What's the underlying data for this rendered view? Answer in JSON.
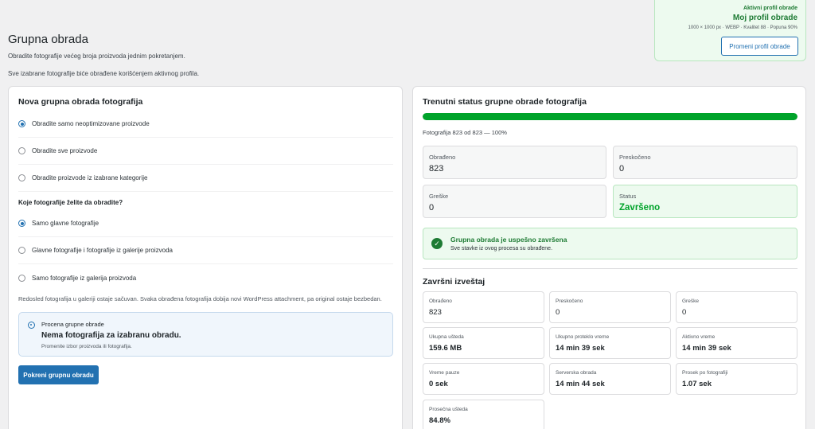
{
  "header": {
    "title": "Grupna obrada",
    "description": "Obradite fotografije većeg broja proizvoda jednim pokretanjem.",
    "description2": "Sve izabrane fotografije biće obrađene korišćenjem aktivnog profila."
  },
  "profile": {
    "label": "Aktivni profil obrade",
    "name": "Moj profil obrade",
    "meta": "1000 × 1000 px · WEBP · Kvalitet 88 · Popuna 90%",
    "button": "Promeni profil obrade"
  },
  "left": {
    "title": "Nova grupna obrada fotografija",
    "scope_options": [
      {
        "label": "Obradite samo neoptimizovane proizvode",
        "checked": true
      },
      {
        "label": "Obradite sve proizvode",
        "checked": false
      },
      {
        "label": "Obradite proizvode iz izabrane kategorije",
        "checked": false
      }
    ],
    "question": "Koje fotografije želite da obradite?",
    "photo_options": [
      {
        "label": "Samo glavne fotografije",
        "checked": true
      },
      {
        "label": "Glavne fotografije i fotografije iz galerije proizvoda",
        "checked": false
      },
      {
        "label": "Samo fotografije iz galerija proizvoda",
        "checked": false
      }
    ],
    "note": "Redosled fotografija u galeriji ostaje sačuvan. Svaka obrađena fotografija dobija novi WordPress attachment, pa original ostaje bezbedan.",
    "estimate": {
      "label": "Procena grupne obrade",
      "title": "Nema fotografija za izabranu obradu.",
      "sub": "Promenite izbor proizvoda ili fotografija."
    },
    "run_button": "Pokreni grupnu obradu"
  },
  "right": {
    "title": "Trenutni status grupne obrade fotografija",
    "progress_text": "Fotografija 823 od 823 — 100%",
    "progress_percent": 100,
    "stats": [
      {
        "label": "Obrađeno",
        "value": "823"
      },
      {
        "label": "Preskočeno",
        "value": "0"
      },
      {
        "label": "Greške",
        "value": "0"
      },
      {
        "label": "Status",
        "value": "Završeno"
      }
    ],
    "success": {
      "title": "Grupna obrada je uspešno završena",
      "sub": "Sve stavke iz ovog procesa su obrađene."
    },
    "report_title": "Završni izveštaj",
    "report": [
      {
        "label": "Obrađeno",
        "value": "823"
      },
      {
        "label": "Preskočeno",
        "value": "0"
      },
      {
        "label": "Greške",
        "value": "0"
      },
      {
        "label": "Ukupna ušteda",
        "value": "159.6 MB"
      },
      {
        "label": "Ukupno proteklo vreme",
        "value": "14 min 39 sek"
      },
      {
        "label": "Aktivno vreme",
        "value": "14 min 39 sek"
      },
      {
        "label": "Vreme pauze",
        "value": "0 sek"
      },
      {
        "label": "Serverska obrada",
        "value": "14 min 44 sek"
      },
      {
        "label": "Prosek po fotografiji",
        "value": "1.07 sek"
      },
      {
        "label": "Prosečna ušteda",
        "value": "84.8%"
      }
    ]
  },
  "colors": {
    "accent": "#2271b1",
    "success": "#00a32a",
    "success_dark": "#1e7b34"
  }
}
